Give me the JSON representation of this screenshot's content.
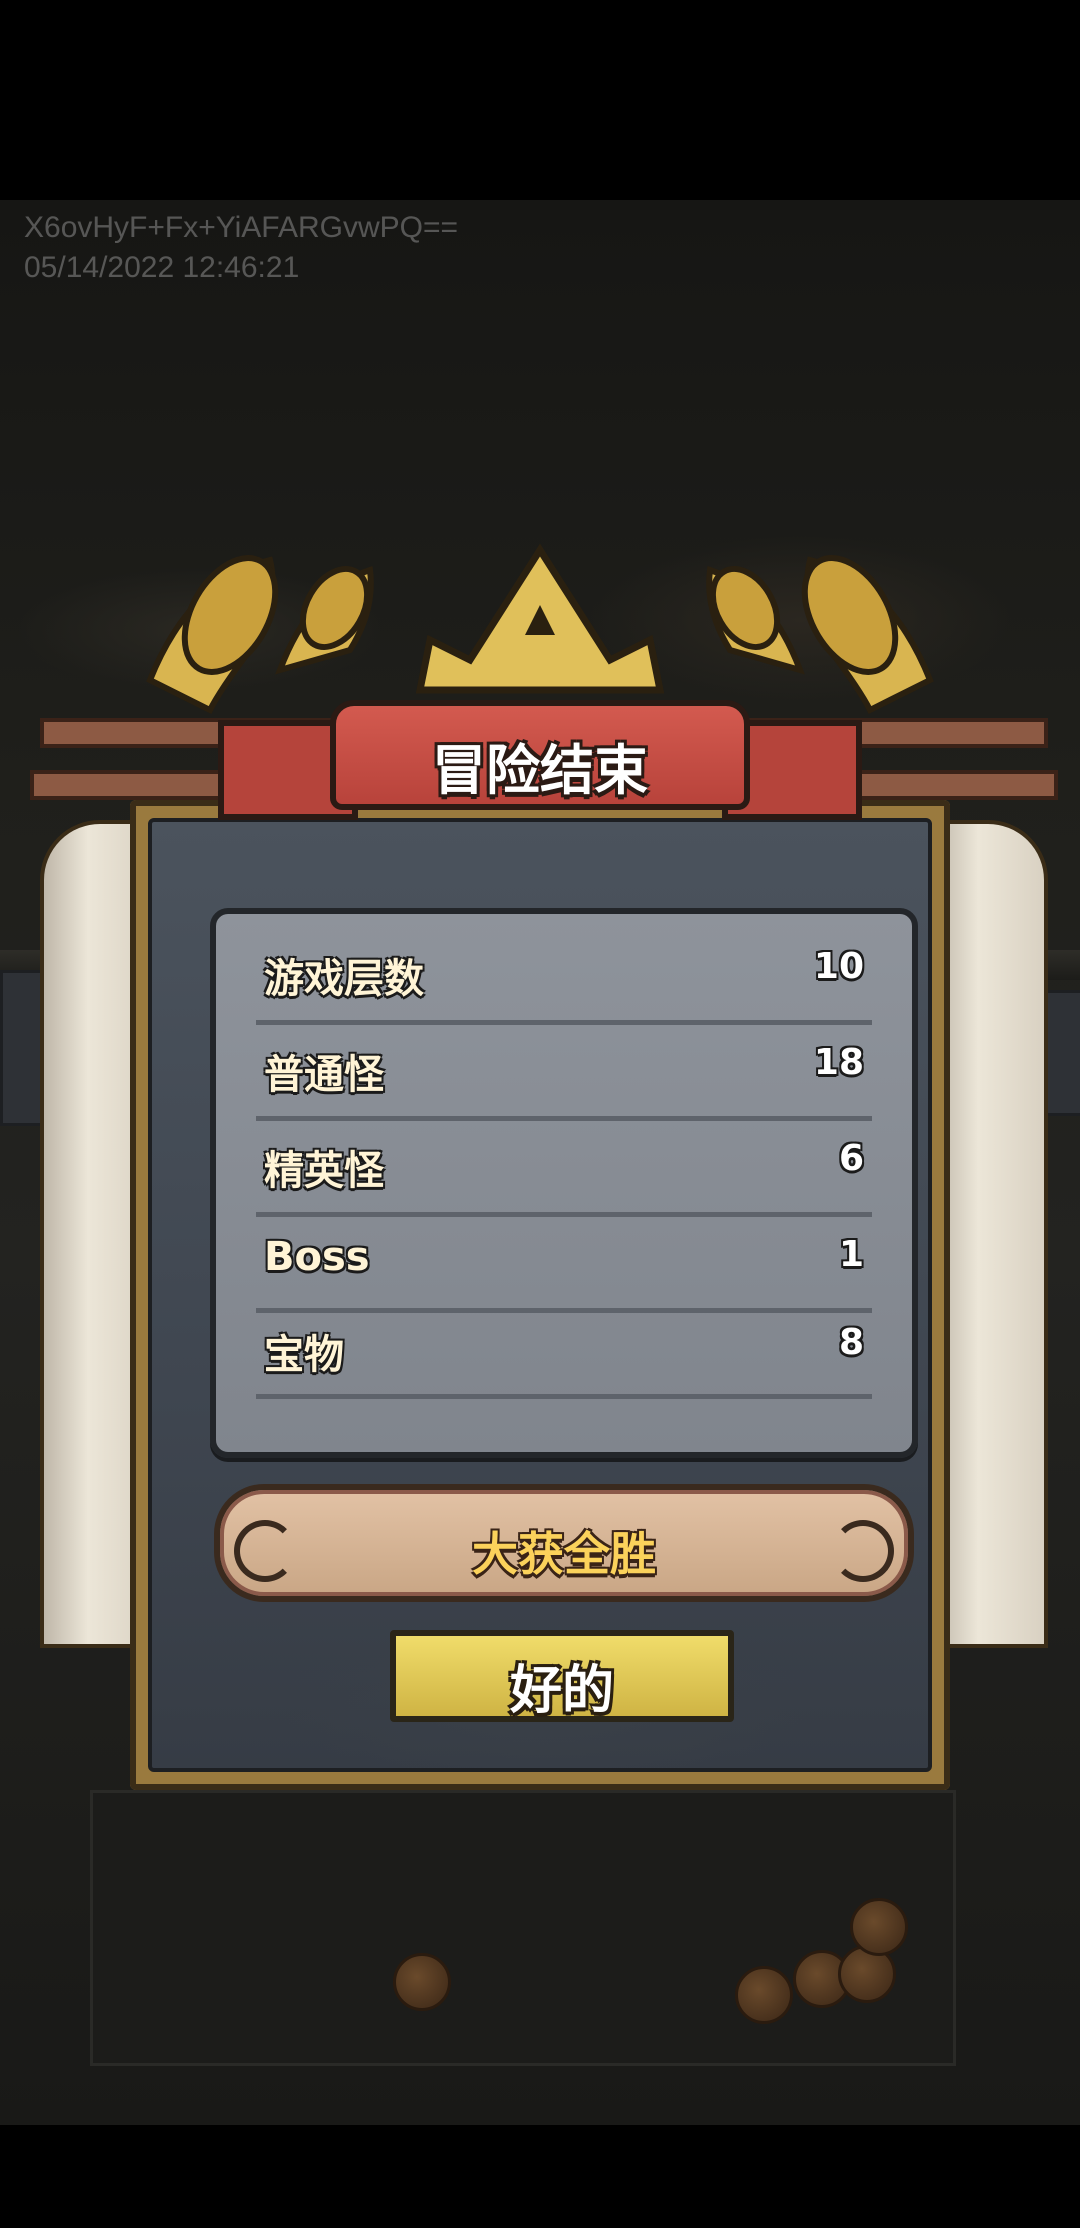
{
  "watermark": {
    "line1": "X6ovHyF+Fx+YiAFARGvwPQ==",
    "line2": "05/14/2022 12:46:21"
  },
  "dialog": {
    "title": "冒险结束",
    "stats": [
      {
        "label": "游戏层数",
        "value": "10"
      },
      {
        "label": "普通怪",
        "value": "18"
      },
      {
        "label": "精英怪",
        "value": "6"
      },
      {
        "label": "Boss",
        "value": "1"
      },
      {
        "label": "宝物",
        "value": "8"
      }
    ],
    "result": "大获全胜",
    "ok_label": "好的"
  },
  "colors": {
    "banner_red": "#c44c42",
    "gold": "#d9b550",
    "panel_gray": "#878c94",
    "result_text": "#fbd25b",
    "button_yellow": "#e3cb5a"
  }
}
